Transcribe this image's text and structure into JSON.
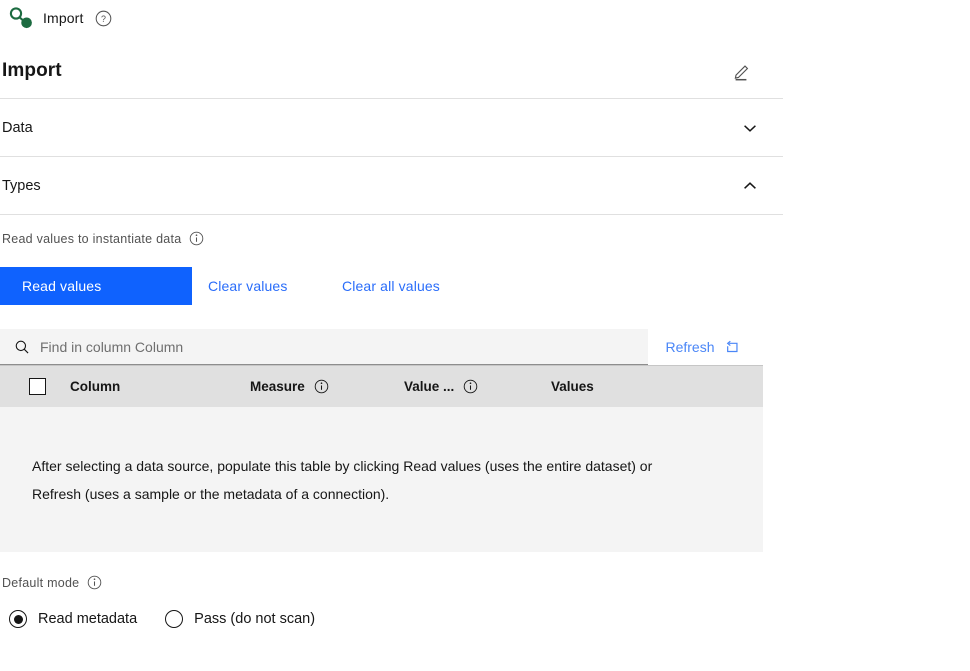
{
  "breadcrumb": {
    "icon": "node-connection-icon",
    "label": "Import",
    "help_icon": "help-icon"
  },
  "header": {
    "title": "Import",
    "edit_icon": "edit-pencil-icon"
  },
  "accordion": [
    {
      "label": "Data",
      "expanded": false,
      "chevron": "chevron-down-icon"
    },
    {
      "label": "Types",
      "expanded": true,
      "chevron": "chevron-up-icon"
    }
  ],
  "read_values": {
    "label": "Read values to instantiate data",
    "info_icon": "info-icon",
    "primary_button": "Read values",
    "clear_values_button": "Clear values",
    "clear_all_values_button": "Clear all values"
  },
  "table": {
    "search": {
      "icon": "search-icon",
      "placeholder": "Find in column Column",
      "value": ""
    },
    "refresh": {
      "label": "Refresh",
      "icon": "reset-icon"
    },
    "columns": [
      {
        "label": "Column",
        "info": false
      },
      {
        "label": "Measure",
        "info": true
      },
      {
        "label": "Value ...",
        "info": true
      },
      {
        "label": "Values",
        "info": false
      }
    ],
    "select_all_checkbox": false,
    "empty_message": "After selecting a data source, populate this table by clicking Read values (uses the entire dataset) or Refresh (uses a sample or the metadata of a connection)."
  },
  "default_mode": {
    "label": "Default mode",
    "info_icon": "info-icon",
    "options": [
      {
        "label": "Read metadata",
        "selected": true
      },
      {
        "label": "Pass (do not scan)",
        "selected": false
      }
    ]
  },
  "colors": {
    "primary_blue": "#0f62fe",
    "link_blue": "#2a6dfa",
    "node_green": "#1c6b40",
    "table_header_bg": "#e0e0e0",
    "table_body_bg": "#f4f4f4",
    "divider": "#e0e0e0"
  }
}
